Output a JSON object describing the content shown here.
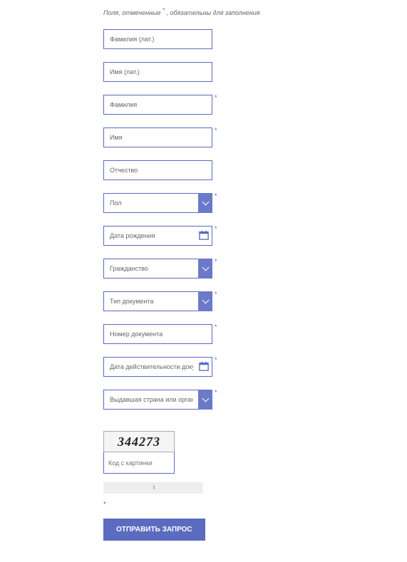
{
  "note_prefix": "Поля, отмеченные ",
  "note_star": "*",
  "note_suffix": " , обязательны для заполнения",
  "fields": {
    "surname_lat": {
      "placeholder": "Фамилия (лат.)",
      "required": false
    },
    "name_lat": {
      "placeholder": "Имя (лат.)",
      "required": false
    },
    "surname": {
      "placeholder": "Фамилия",
      "required": true
    },
    "name": {
      "placeholder": "Имя",
      "required": true
    },
    "patronymic": {
      "placeholder": "Отчество",
      "required": false
    },
    "gender": {
      "placeholder": "Пол",
      "required": true
    },
    "dob": {
      "placeholder": "Дата рождения",
      "required": true
    },
    "citizenship": {
      "placeholder": "Гражданство",
      "required": true
    },
    "doc_type": {
      "placeholder": "Тип документа",
      "required": true
    },
    "doc_number": {
      "placeholder": "Номер документа",
      "required": true
    },
    "doc_valid": {
      "placeholder": "Дата действительности документа",
      "required": true
    },
    "issuing": {
      "placeholder": "Выдавшая страна или организация",
      "required": true
    },
    "captcha": {
      "placeholder": "Код с картинки"
    }
  },
  "captcha_value": "344273",
  "required_marker": "*",
  "submit_label": "ОТПРАВИТЬ ЗАПРОС"
}
